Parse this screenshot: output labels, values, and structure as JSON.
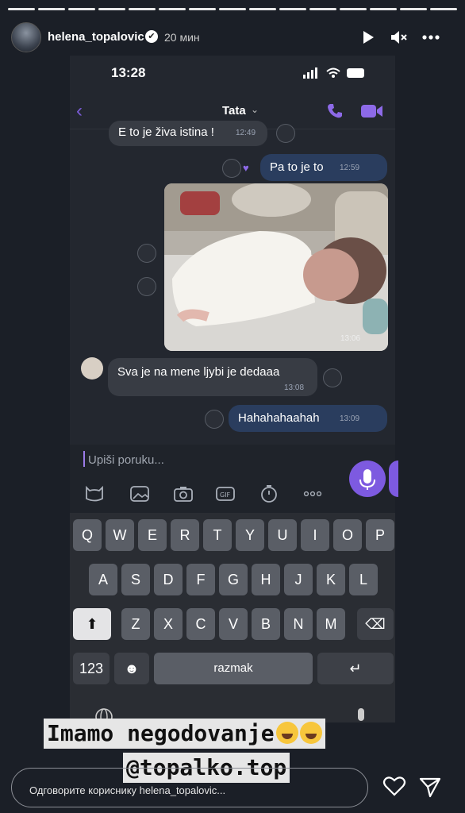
{
  "story": {
    "progress_segments": 15,
    "username": "helena_topalovic",
    "age": "20 мин",
    "reply_placeholder": "Одговорите кориснику helena_topalovic..."
  },
  "phone": {
    "time": "13:28",
    "contact": "Tata"
  },
  "messages": [
    {
      "dir": "in",
      "text": "E to je živa istina !",
      "time": "12:49"
    },
    {
      "dir": "out",
      "text": "Pa to je to",
      "time": "12:59"
    },
    {
      "dir": "out",
      "type": "photo",
      "time": "13:06"
    },
    {
      "dir": "in",
      "text": "Sva je na mene ljybi je dedaaa",
      "time": "13:08"
    },
    {
      "dir": "out",
      "text": "Hahahahaahah",
      "time": "13:09"
    }
  ],
  "composer": {
    "placeholder": "Upiši poruku..."
  },
  "keyboard": {
    "row1": [
      "Q",
      "W",
      "E",
      "R",
      "T",
      "Y",
      "U",
      "I",
      "O",
      "P"
    ],
    "row2": [
      "A",
      "S",
      "D",
      "F",
      "G",
      "H",
      "J",
      "K",
      "L"
    ],
    "row3": [
      "Z",
      "X",
      "C",
      "V",
      "B",
      "N",
      "M"
    ],
    "num_key": "123",
    "space_label": "razmak"
  },
  "overlay": {
    "line1": "Imamo negodovanje",
    "line2": "@topalko.top"
  },
  "colors": {
    "accent": "#7d5ae0",
    "outgoing": "#2a3d5e",
    "incoming": "#383c44"
  }
}
